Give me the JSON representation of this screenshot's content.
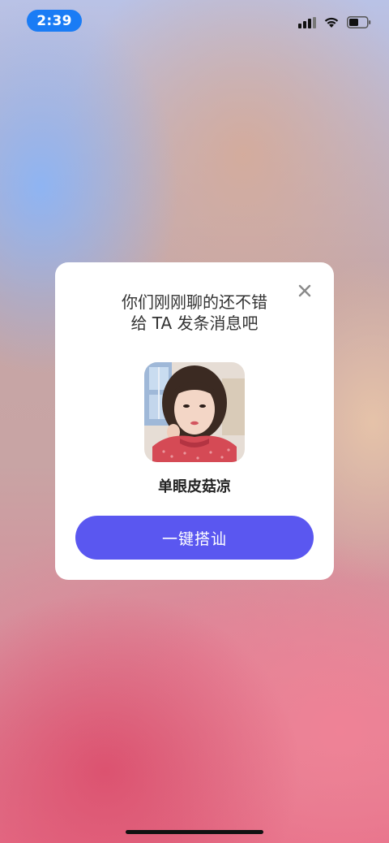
{
  "status_bar": {
    "time": "2:39",
    "icons": [
      "cellular-signal-icon",
      "wifi-icon",
      "battery-icon"
    ],
    "time_pill_color": "#1a7cf5"
  },
  "modal": {
    "title_line1": "你们刚刚聊的还不错",
    "title_line2": "给 TA 发条消息吧",
    "close_icon": "close-icon",
    "username": "单眼皮菇凉",
    "button_label": "一键搭讪",
    "button_color": "#5a57f0"
  }
}
